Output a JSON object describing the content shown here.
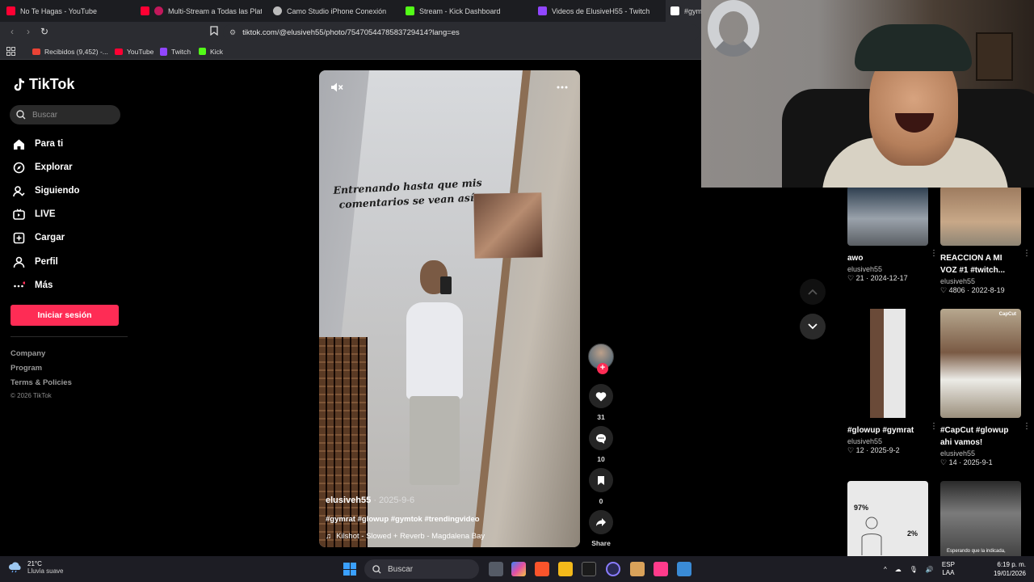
{
  "browser": {
    "tabs": [
      {
        "label": "No Te Hagas - YouTube",
        "color": "#ff0033"
      },
      {
        "label": "Multi-Stream a Todas las Platafor",
        "color": "#ff0033"
      },
      {
        "label": "Camo Studio iPhone Conexión",
        "color": "#bbbbbb"
      },
      {
        "label": "Stream - Kick Dashboard",
        "color": "#53fc18"
      },
      {
        "label": "Videos de ElusiveH55 - Twitch",
        "color": "#9146ff"
      },
      {
        "label": "#gym",
        "color": "#ffffff"
      }
    ],
    "url": "tiktok.com/@elusiveh55/photo/7547054478583729414?lang=es",
    "bookmarks": [
      {
        "label": "Recibidos (9,452) -...",
        "color": "#ea4335"
      },
      {
        "label": "YouTube",
        "color": "#ff0033"
      },
      {
        "label": "Twitch",
        "color": "#9146ff"
      },
      {
        "label": "Kick",
        "color": "#53fc18"
      }
    ]
  },
  "tiktok": {
    "logo": "TikTok",
    "search_placeholder": "Buscar",
    "nav": [
      {
        "label": "Para ti",
        "icon": "home-icon"
      },
      {
        "label": "Explorar",
        "icon": "compass-icon"
      },
      {
        "label": "Siguiendo",
        "icon": "following-icon"
      },
      {
        "label": "LIVE",
        "icon": "live-icon"
      },
      {
        "label": "Cargar",
        "icon": "upload-icon"
      },
      {
        "label": "Perfil",
        "icon": "profile-icon"
      },
      {
        "label": "Más",
        "icon": "more-icon"
      }
    ],
    "login_button": "Iniciar sesión",
    "footer": {
      "company": "Company",
      "program": "Program",
      "terms": "Terms & Policies",
      "copyright": "© 2026 TikTok"
    },
    "accent": "#fe2c55"
  },
  "video": {
    "overlay_text_line1": "Entrenando hasta que mis",
    "overlay_text_line2": "comentarios se vean así:",
    "author": "elusiveh55",
    "date": "· 2025-9-6",
    "tags": "#gymrat #glowup #gymtok #trendingvideo",
    "music": "Kilshot - Slowed + Reverb - Magdalena Bay",
    "likes": "31",
    "comments": "10",
    "saves": "0",
    "share_label": "Share"
  },
  "related": [
    {
      "title": "awo",
      "author": "elusiveh55",
      "likes": "21",
      "date": "· 2024-12-17"
    },
    {
      "title": "REACCION A MI",
      "title2": "VOZ #1 #twitch...",
      "author": "elusiveh55",
      "likes": "4806",
      "date": "· 2022-8-19"
    },
    {
      "title": "#glowup #gymrat",
      "author": "elusiveh55",
      "likes": "12",
      "date": "· 2025-9-2"
    },
    {
      "title": "#CapCut #glowup",
      "title2": "ahi vamos!",
      "author": "elusiveh55",
      "likes": "14",
      "date": "· 2025-9-1"
    },
    {
      "thumb_text1": "97%",
      "thumb_text2": "2%"
    },
    {
      "thumb_text": "Esperando que la indicada,"
    }
  ],
  "capcut_label": "CapCut",
  "taskbar": {
    "temp": "21°C",
    "weather": "Lluvia suave",
    "search": "Buscar",
    "lang1": "ESP",
    "lang2": "LAA",
    "time": "6:19 p. m.",
    "date": "19/01/2026"
  }
}
